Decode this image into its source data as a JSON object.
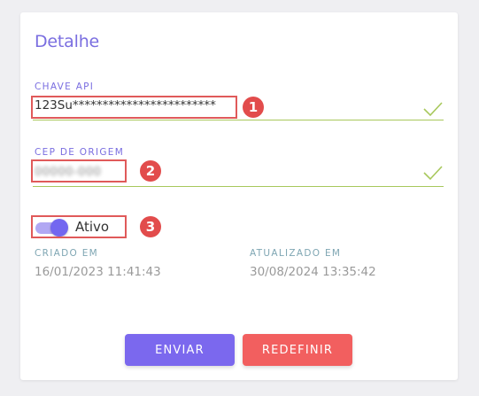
{
  "card": {
    "title": "Detalhe"
  },
  "api_key": {
    "label": "CHAVE API",
    "value": "123Su************************",
    "valid": true
  },
  "cep": {
    "label": "CEP DE ORIGEM",
    "value": "00000-000",
    "valid": true
  },
  "active": {
    "label": "Ativo",
    "on": true
  },
  "created": {
    "label": "CRIADO EM",
    "value": "16/01/2023 11:41:43"
  },
  "updated": {
    "label": "ATUALIZADO EM",
    "value": "30/08/2024 13:35:42"
  },
  "buttons": {
    "send": "ENVIAR",
    "reset": "REDEFINIR"
  },
  "annotations": [
    "1",
    "2",
    "3"
  ],
  "colors": {
    "accent": "#7367f0",
    "valid_line": "#a8c85c",
    "reset": "#f25f5f",
    "annotation": "#e24c4c"
  }
}
